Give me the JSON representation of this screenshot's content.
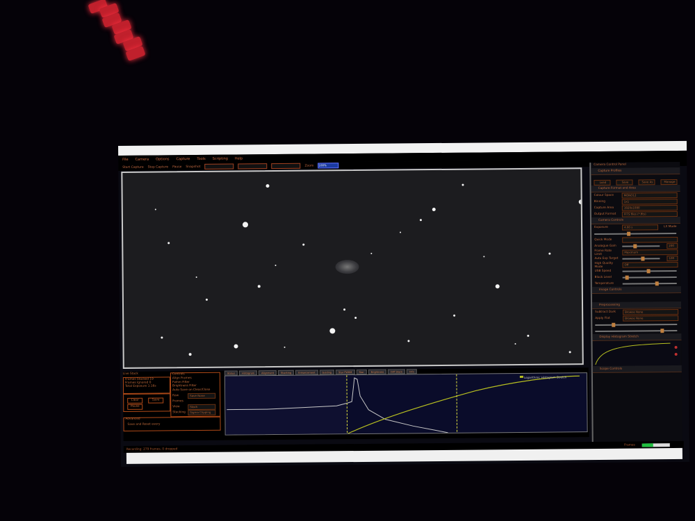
{
  "menu": [
    "File",
    "Camera",
    "Options",
    "Capture",
    "Tools",
    "Scripting",
    "Help"
  ],
  "toolbar": {
    "items": [
      "Start Capture",
      "Stop Capture",
      "Pause",
      "Snapshot",
      "Zoom"
    ],
    "zoom_value": "100%"
  },
  "ccp": {
    "title": "Camera Control Panel",
    "sections": {
      "profiles": "Capture Profiles",
      "format": "Capture Format and Area",
      "controls": "Camera Controls",
      "image": "Image Controls",
      "preproc": "Preprocessing",
      "histo_stretch": "Display Histogram Stretch",
      "scope": "Scope Controls"
    },
    "buttons": [
      "Load",
      "Save",
      "Save As",
      "Manage"
    ],
    "format_rows": [
      {
        "label": "Colour Space",
        "value": "MONO12"
      },
      {
        "label": "Binning",
        "value": "1x1"
      },
      {
        "label": "Capture Area",
        "value": "1920x1080"
      },
      {
        "label": "Output Format",
        "value": "FITS files (*.fits)"
      }
    ],
    "control_rows": [
      {
        "label": "Exposure",
        "value": "4.00 s"
      },
      {
        "label": "Quick Mode",
        "value": ""
      },
      {
        "label": "Analogue Gain",
        "value": "200"
      },
      {
        "label": "Frame Rate Limit",
        "value": "Maximum"
      },
      {
        "label": "Auto Exp Target",
        "value": "100"
      },
      {
        "label": "High Quality Mode",
        "value": "Off"
      },
      {
        "label": "USB Speed",
        "value": ""
      },
      {
        "label": "Black Level",
        "value": ""
      },
      {
        "label": "Temperature",
        "value": ""
      }
    ],
    "preproc_rows": [
      {
        "label": "Subtract Dark",
        "value": "Browse None"
      },
      {
        "label": "Apply Flat",
        "value": "Browse None"
      }
    ],
    "checkbox": "LX Mode"
  },
  "livestack": {
    "title": "Live Stack",
    "stats": [
      {
        "label": "Frames Stacked",
        "value": "19"
      },
      {
        "label": "Frames Ignored",
        "value": "0"
      },
      {
        "label": "Total Exposure",
        "value": "1:16s"
      }
    ],
    "buttons": [
      "Clear",
      "Save",
      "Pause"
    ],
    "controls_title": "Controls",
    "checks": [
      "Align Frames",
      "Fwhm Filter",
      "Brightness Filter",
      "Auto Save on Clear/Close"
    ],
    "fields": [
      {
        "label": "Raw Frames",
        "value": "Save None"
      },
      {
        "label": "View",
        "value": "Stack"
      },
      {
        "label": "Stacking",
        "value": "Sigma Clipping"
      }
    ],
    "advanced": "Advanced",
    "advanced_check": "Save and Reset every"
  },
  "histogram": {
    "tabs": [
      "Status",
      "Histogram",
      "Alignment",
      "Stacking",
      "Enhancement",
      "Guiding",
      "Star FWHM",
      "Star",
      "Brightness",
      "Diff Stack",
      "Info"
    ],
    "legend": "Logarithmic Histogram Stretch"
  },
  "status": {
    "left": "Recording: 279 frames, 0 dropped",
    "right_label": "Frames"
  },
  "colors": {
    "accent": "#c06a3a",
    "curve": "#b8c020",
    "histogram_line": "#c8c8c8"
  }
}
